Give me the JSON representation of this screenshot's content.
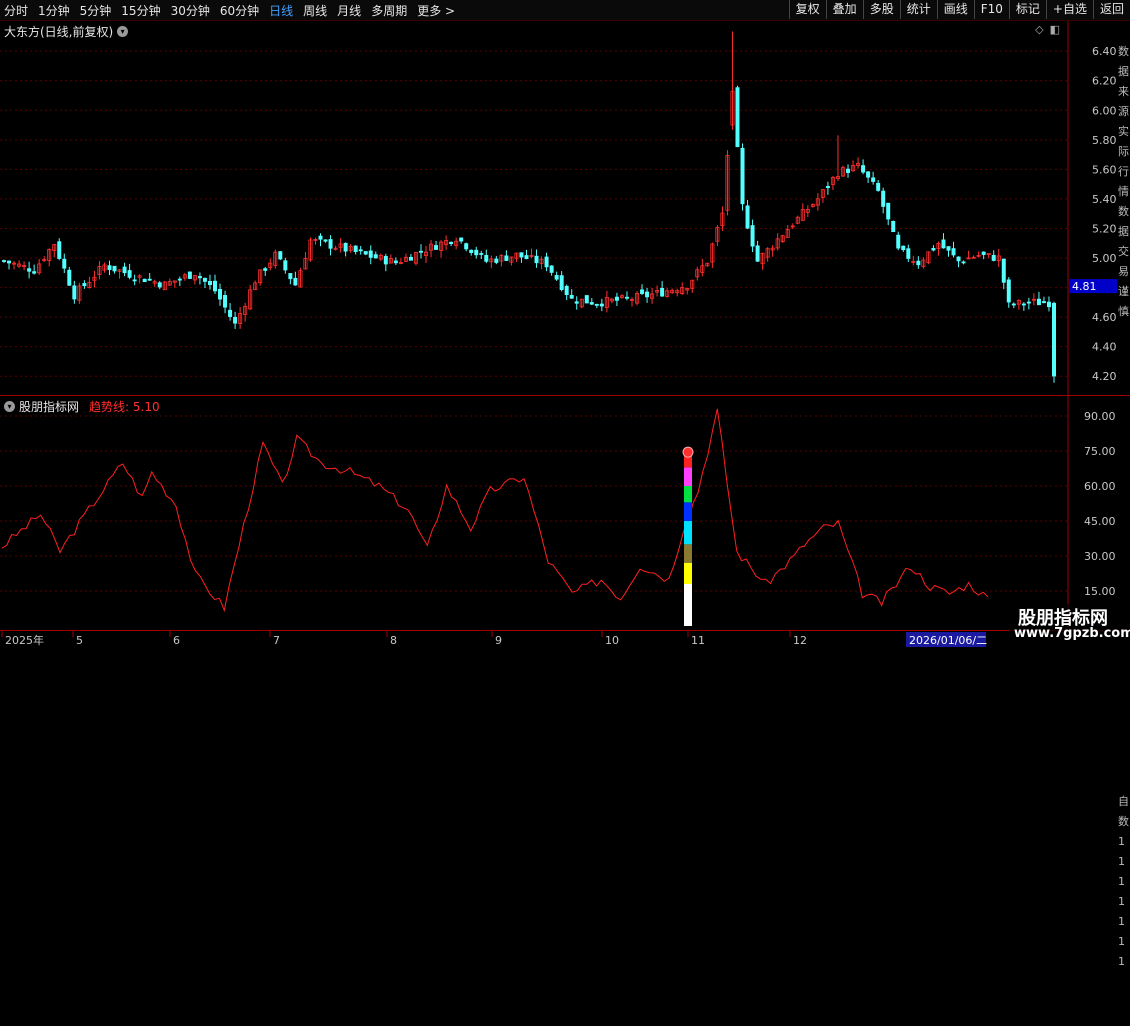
{
  "toolbar": {
    "periods": [
      "分时",
      "1分钟",
      "5分钟",
      "15分钟",
      "30分钟",
      "60分钟",
      "日线",
      "周线",
      "月线",
      "多周期",
      "更多 >"
    ],
    "active_period": "日线",
    "buttons": [
      "复权",
      "叠加",
      "多股",
      "统计",
      "画线",
      "F10",
      "标记",
      "+自选",
      "返回"
    ]
  },
  "main_panel": {
    "title": "大东方(日线,前复权)",
    "corner_icons": [
      "◇",
      "◧"
    ],
    "current_price_tag": "4.81",
    "right_strip_text": "数据来源实际行情数据交易谨慎"
  },
  "indicator_panel": {
    "title": "股朋指标网",
    "trend_label": "趋势线: 5.10",
    "right_strip_text": "自数1111111"
  },
  "watermark": {
    "title": "股朋指标网",
    "url": "www.7gpzb.com"
  },
  "date_axis": {
    "labels": [
      "2025年",
      "5",
      "6",
      "7",
      "8",
      "9",
      "10",
      "11",
      "12"
    ],
    "current_date": "2026/01/06/二"
  },
  "colors": {
    "up": "#ff3030",
    "down": "#54ffff",
    "grid": "#5a0000",
    "axis": "#a00000",
    "trend": "#ff2020",
    "price_tag_bg": "#0000c8"
  },
  "chart_data": [
    {
      "type": "candlestick",
      "title": "大东方(日线,前复权)",
      "ylim": [
        4.1,
        6.55
      ],
      "y_ticks": [
        6.4,
        6.2,
        6.0,
        5.8,
        5.6,
        5.4,
        5.2,
        5.0,
        4.8,
        4.6,
        4.4,
        4.2
      ],
      "close_keypoints": [
        [
          0,
          4.98
        ],
        [
          6,
          4.92
        ],
        [
          10,
          5.1
        ],
        [
          14,
          4.75
        ],
        [
          20,
          4.95
        ],
        [
          26,
          4.88
        ],
        [
          32,
          4.82
        ],
        [
          38,
          4.9
        ],
        [
          42,
          4.78
        ],
        [
          46,
          4.55
        ],
        [
          50,
          4.85
        ],
        [
          54,
          5.02
        ],
        [
          58,
          4.82
        ],
        [
          61,
          5.12
        ],
        [
          66,
          5.08
        ],
        [
          72,
          5.02
        ],
        [
          78,
          4.97
        ],
        [
          84,
          5.06
        ],
        [
          90,
          5.14
        ],
        [
          96,
          4.98
        ],
        [
          102,
          5.02
        ],
        [
          108,
          4.96
        ],
        [
          113,
          4.72
        ],
        [
          118,
          4.7
        ],
        [
          124,
          4.72
        ],
        [
          130,
          4.76
        ],
        [
          136,
          4.82
        ],
        [
          140,
          4.98
        ],
        [
          143,
          5.3
        ],
        [
          145,
          6.1
        ],
        [
          147,
          5.35
        ],
        [
          150,
          4.98
        ],
        [
          156,
          5.2
        ],
        [
          162,
          5.4
        ],
        [
          166,
          5.58
        ],
        [
          170,
          5.62
        ],
        [
          174,
          5.45
        ],
        [
          178,
          5.05
        ],
        [
          182,
          4.97
        ],
        [
          186,
          5.1
        ],
        [
          190,
          4.98
        ],
        [
          194,
          5.02
        ],
        [
          198,
          5.0
        ],
        [
          200,
          4.68
        ],
        [
          204,
          4.7
        ],
        [
          208,
          4.7
        ],
        [
          209,
          4.22
        ]
      ],
      "current_price": 4.81
    },
    {
      "type": "line",
      "title": "股朋指标网",
      "series": [
        {
          "name": "趋势线",
          "values_keypoints": [
            [
              0,
              34
            ],
            [
              8,
              48
            ],
            [
              12,
              32
            ],
            [
              18,
              50
            ],
            [
              25,
              70
            ],
            [
              29,
              55
            ],
            [
              31,
              66
            ],
            [
              36,
              52
            ],
            [
              40,
              22
            ],
            [
              46,
              8
            ],
            [
              54,
              78
            ],
            [
              58,
              60
            ],
            [
              61,
              80
            ],
            [
              66,
              70
            ],
            [
              72,
              66
            ],
            [
              78,
              60
            ],
            [
              84,
              50
            ],
            [
              88,
              33
            ],
            [
              92,
              60
            ],
            [
              97,
              42
            ],
            [
              101,
              58
            ],
            [
              108,
              64
            ],
            [
              113,
              28
            ],
            [
              118,
              14
            ],
            [
              124,
              20
            ],
            [
              128,
              12
            ],
            [
              132,
              26
            ],
            [
              138,
              20
            ],
            [
              141,
              42
            ],
            [
              144,
              58
            ],
            [
              148,
              92
            ],
            [
              152,
              32
            ],
            [
              158,
              18
            ],
            [
              164,
              30
            ],
            [
              166,
              35
            ],
            [
              170,
              42
            ],
            [
              173,
              44
            ],
            [
              178,
              14
            ],
            [
              182,
              10
            ],
            [
              188,
              26
            ],
            [
              192,
              17
            ],
            [
              196,
              14
            ],
            [
              200,
              18
            ],
            [
              204,
              12
            ]
          ]
        }
      ],
      "ylim": [
        0,
        96
      ],
      "y_ticks": [
        90.0,
        75.0,
        60.0,
        45.0,
        30.0,
        15.0
      ]
    }
  ]
}
